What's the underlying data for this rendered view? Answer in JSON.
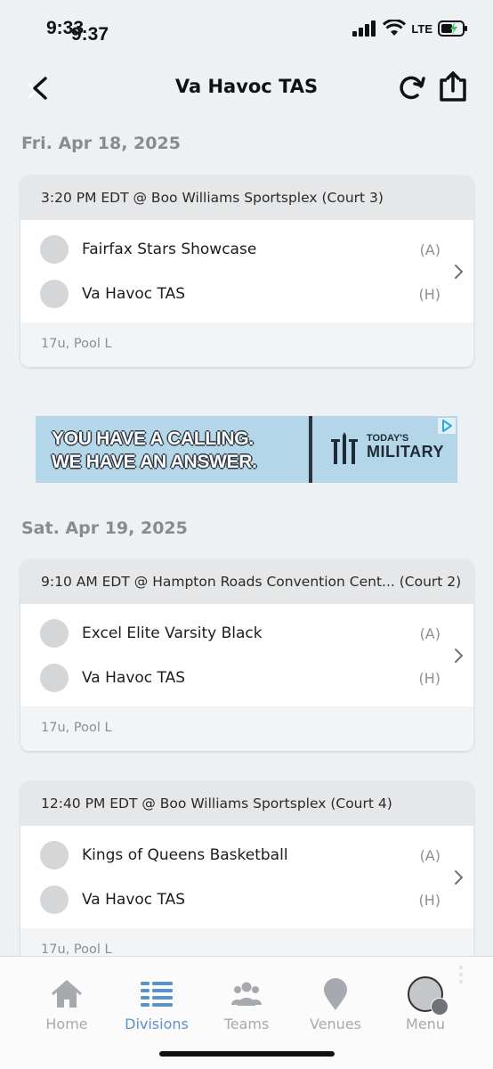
{
  "status_bar": {
    "time_primary": "9:33",
    "time_secondary": "9:37",
    "network": "LTE"
  },
  "header": {
    "title": "Va Havoc TAS"
  },
  "days": [
    {
      "date": "Fri. Apr 18, 2025",
      "games": [
        {
          "header": "3:20 PM EDT @ Boo Williams Sportsplex (Court 3)",
          "teams": [
            {
              "name": "Fairfax Stars Showcase",
              "side": "(A)"
            },
            {
              "name": "Va Havoc TAS",
              "side": "(H)"
            }
          ],
          "footer": "17u, Pool L"
        }
      ]
    },
    {
      "date": "Sat. Apr 19, 2025",
      "games": [
        {
          "header": "9:10 AM EDT @ Hampton Roads Convention Cent... (Court 2)",
          "teams": [
            {
              "name": "Excel Elite Varsity Black",
              "side": "(A)"
            },
            {
              "name": "Va Havoc TAS",
              "side": "(H)"
            }
          ],
          "footer": "17u, Pool L"
        },
        {
          "header": "12:40 PM EDT @ Boo Williams Sportsplex (Court 4)",
          "teams": [
            {
              "name": "Kings of Queens Basketball",
              "side": "(A)"
            },
            {
              "name": "Va Havoc TAS",
              "side": "(H)"
            }
          ],
          "footer": "17u, Pool L"
        }
      ]
    }
  ],
  "ad": {
    "line1": "YOU HAVE A CALLING.",
    "line2": "WE HAVE AN ANSWER.",
    "brand_small": "TODAY'S",
    "brand_large": "MILITARY"
  },
  "tabs": [
    {
      "label": "Home",
      "icon": "home-icon",
      "active": false
    },
    {
      "label": "Divisions",
      "icon": "list-icon",
      "active": true
    },
    {
      "label": "Teams",
      "icon": "people-icon",
      "active": false
    },
    {
      "label": "Venues",
      "icon": "location-pin-icon",
      "active": false
    },
    {
      "label": "Menu",
      "icon": "avatar-menu-icon",
      "active": false
    }
  ],
  "colors": {
    "accent": "#5b93c8",
    "background": "#eef1f3",
    "card_header": "#e6e7e9",
    "inactive": "#a6a9ad"
  }
}
